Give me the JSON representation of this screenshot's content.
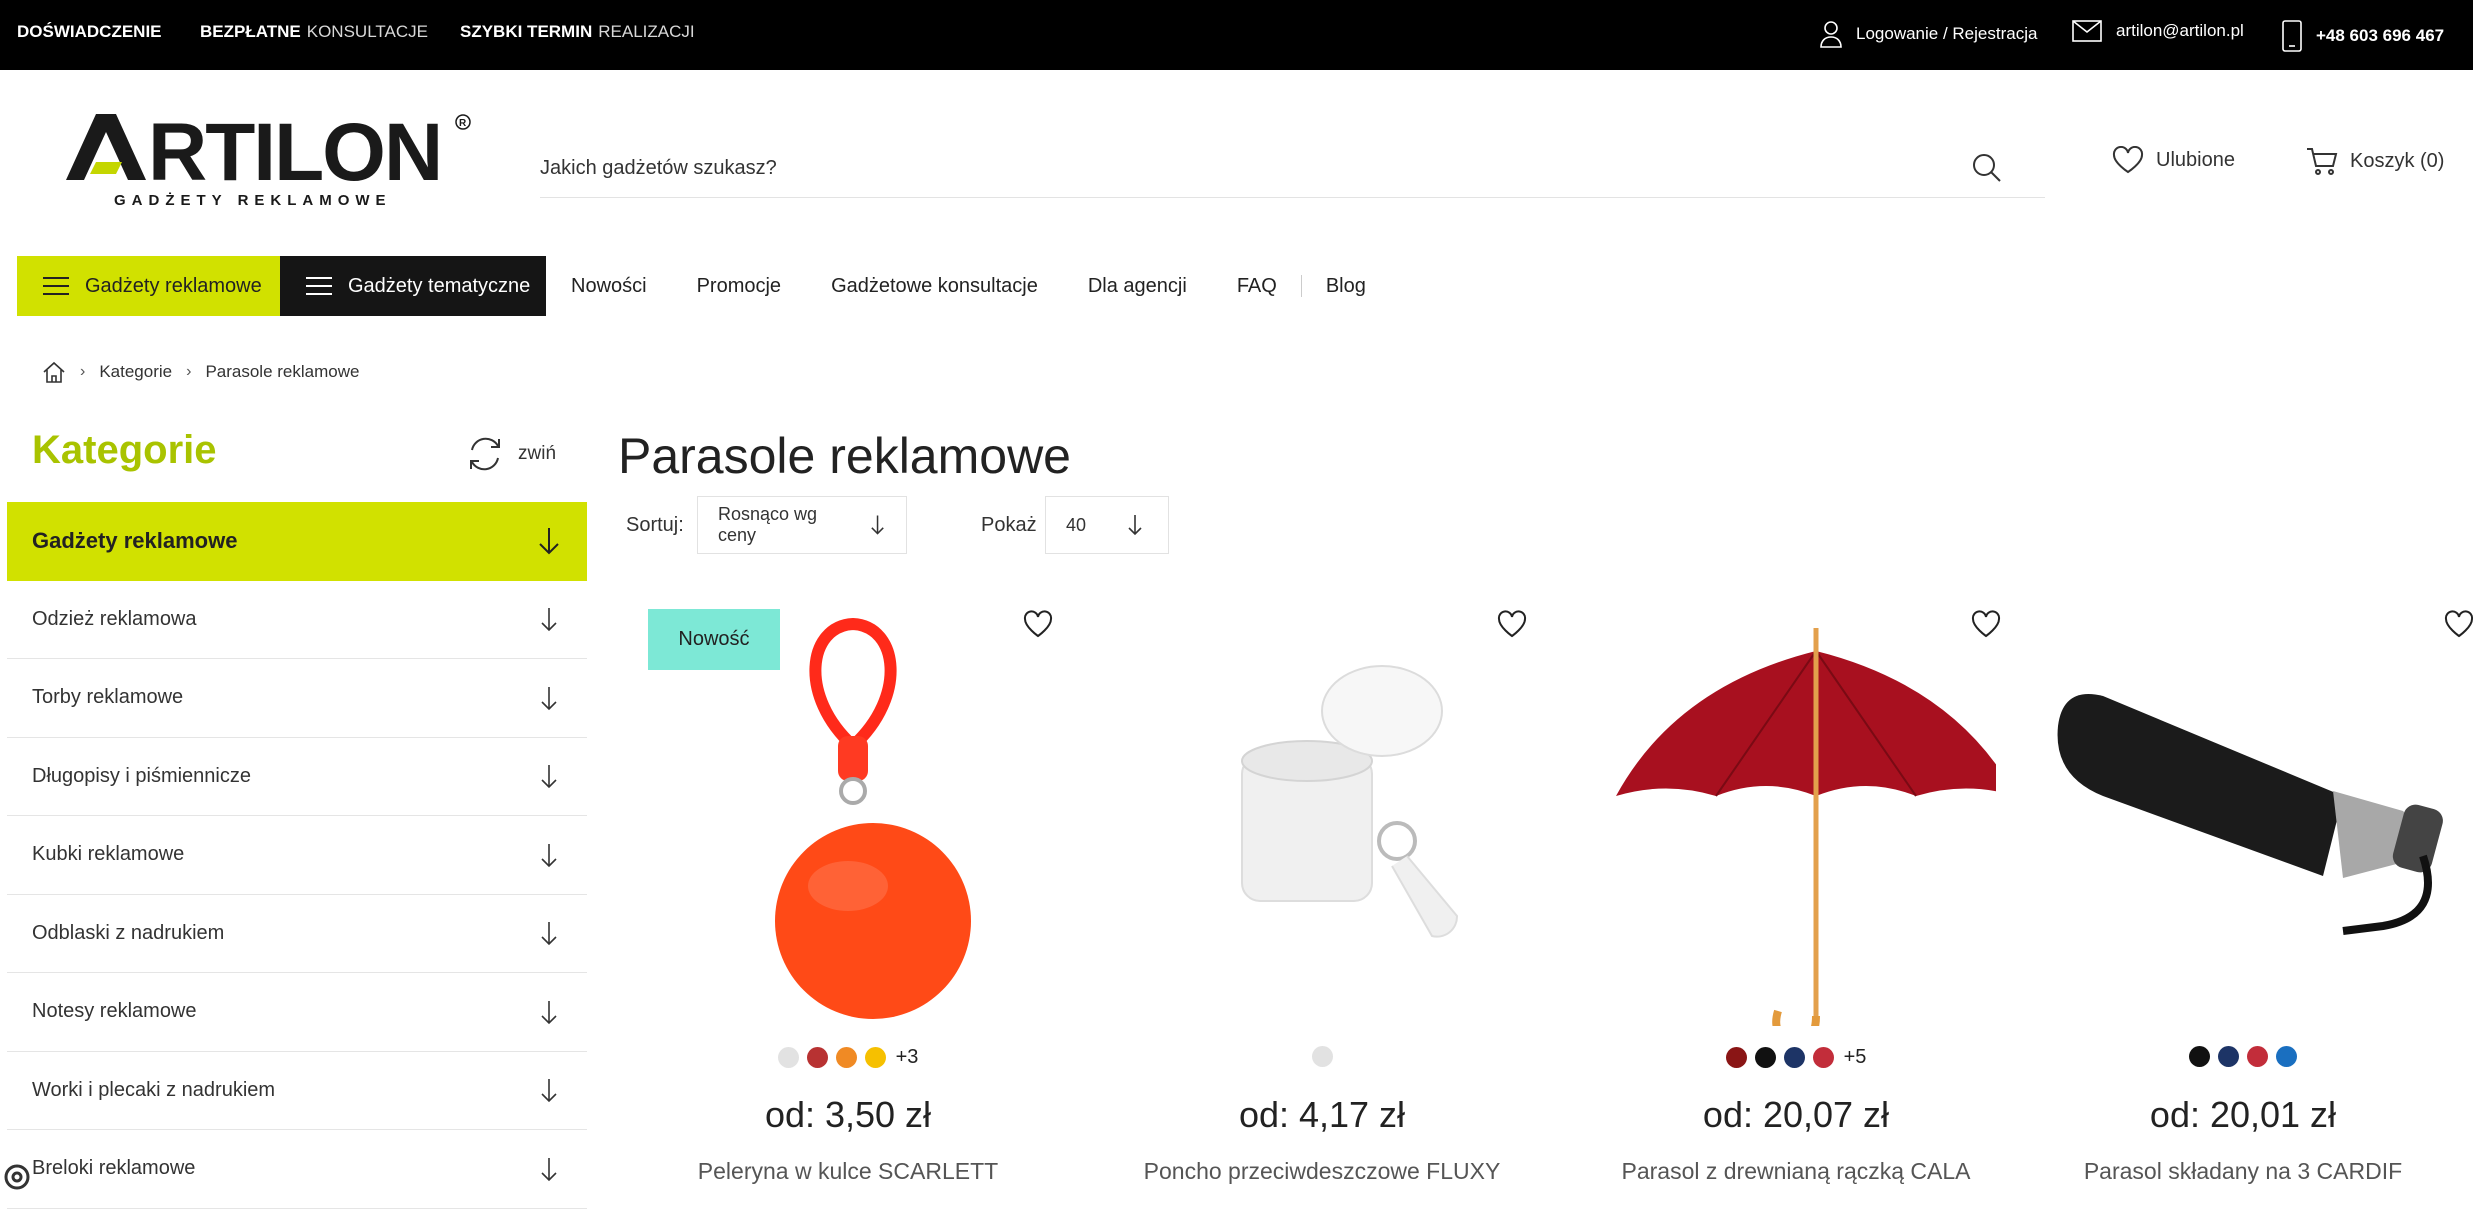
{
  "topbar": {
    "promo1_bold": "DOŚWIADCZENIE",
    "promo2_bold": "BEZPŁATNE",
    "promo2_light": "KONSULTACJE",
    "promo3_bold": "SZYBKI TERMIN",
    "promo3_light": "REALIZACJI",
    "login": "Logowanie / Rejestracja",
    "email": "artilon@artilon.pl",
    "phone": "+48 603 696 467"
  },
  "logo": {
    "brand": "ARTILON",
    "tagline": "GADŻETY REKLAMOWE"
  },
  "search": {
    "placeholder": "Jakich gadżetów szukasz?"
  },
  "header": {
    "favorites": "Ulubione",
    "cart": "Koszyk (0)"
  },
  "nav": {
    "menu1": "Gadżety reklamowe",
    "menu2": "Gadżety tematyczne",
    "links": [
      "Nowości",
      "Promocje",
      "Gadżetowe konsultacje",
      "Dla agencji",
      "FAQ",
      "Blog"
    ]
  },
  "breadcrumb": [
    "Kategorie",
    "Parasole reklamowe"
  ],
  "sidebar": {
    "title": "Kategorie",
    "collapse": "zwiń",
    "items": [
      "Gadżety reklamowe",
      "Odzież reklamowa",
      "Torby reklamowe",
      "Długopisy i piśmiennicze",
      "Kubki reklamowe",
      "Odblaski z nadrukiem",
      "Notesy reklamowe",
      "Worki i plecaki z nadrukiem",
      "Breloki reklamowe"
    ]
  },
  "main": {
    "title": "Parasole reklamowe",
    "sort_label": "Sortuj:",
    "sort_value": "Rosnąco wg ceny",
    "show_label": "Pokaż",
    "show_value": "40"
  },
  "products": [
    {
      "badge": "Nowość",
      "colors": [
        "#e2e2e2",
        "#b83232",
        "#f08a24",
        "#f6c000"
      ],
      "more": "+3",
      "price": "od: 3,50 zł",
      "name": "Peleryna w kulce SCARLETT"
    },
    {
      "badge": "",
      "colors": [
        "#e2e2e2"
      ],
      "more": "",
      "price": "od: 4,17 zł",
      "name": "Poncho przeciwdeszczowe FLUXY"
    },
    {
      "badge": "",
      "colors": [
        "#8a1515",
        "#111111",
        "#1d3466",
        "#c22d3a"
      ],
      "more": "+5",
      "price": "od: 20,07 zł",
      "name": "Parasol z drewnianą rączką CALA"
    },
    {
      "badge": "",
      "colors": [
        "#111111",
        "#1d3466",
        "#c22d3a",
        "#1a6fc0"
      ],
      "more": "",
      "price": "od: 20,01 zł",
      "name": "Parasol składany na 3 CARDIF"
    }
  ],
  "colors": {
    "accent_lime": "#d1e100",
    "title_green": "#a9c300",
    "badge_mint": "#7de8d6"
  }
}
